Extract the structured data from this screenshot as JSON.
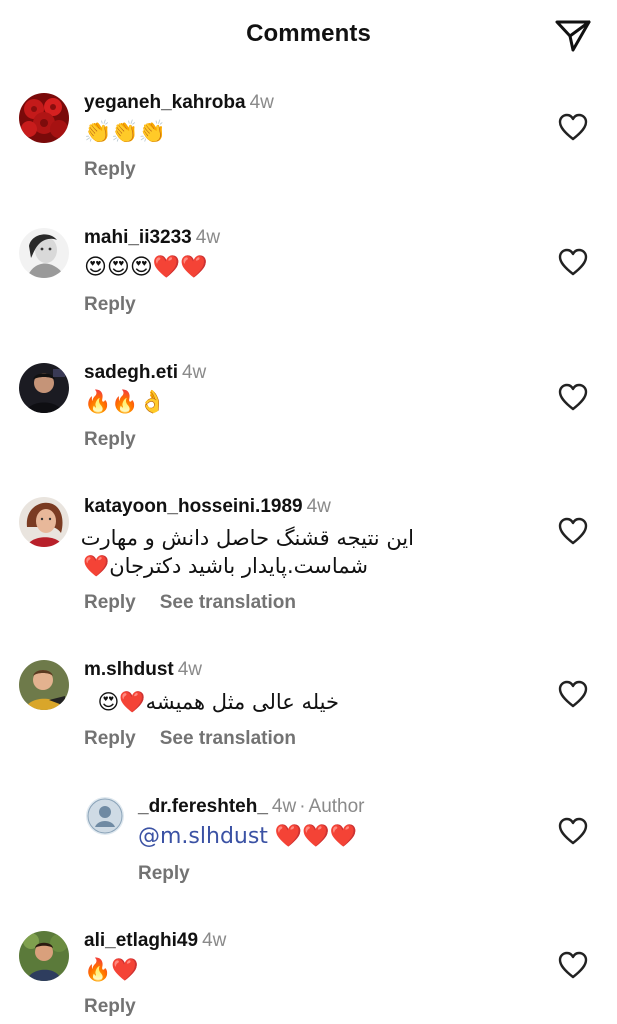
{
  "header": {
    "title": "Comments"
  },
  "comments": [
    {
      "username": "yeganeh_kahroba",
      "time": "4w",
      "text": "👏👏👏",
      "reply_label": "Reply"
    },
    {
      "username": "mahi_ii3233",
      "time": "4w",
      "text": "😍😍😍❤️❤️",
      "reply_label": "Reply"
    },
    {
      "username": "sadegh.eti",
      "time": "4w",
      "text": "🔥🔥👌",
      "reply_label": "Reply"
    },
    {
      "username": "katayoon_hosseini.1989",
      "time": "4w",
      "text_line1": "این نتیجه قشنگ حاصل دانش و مهارت",
      "text_line2": "شماست.پایدار باشید دکترجان❤️",
      "reply_label": "Reply",
      "translate_label": "See translation"
    },
    {
      "username": "m.slhdust",
      "time": "4w",
      "text": "خیله عالی مثل همیشه❤️😍",
      "reply_label": "Reply",
      "translate_label": "See translation"
    },
    {
      "username": "_dr.fereshteh_",
      "time": "4w",
      "author_label": "Author",
      "mention": "@m.slhdust",
      "text": " ❤️❤️❤️",
      "reply_label": "Reply"
    },
    {
      "username": "ali_etlaghi49",
      "time": "4w",
      "text": "🔥❤️",
      "reply_label": "Reply"
    }
  ],
  "icons": {
    "send": "paper-plane-icon",
    "like": "heart-outline-icon"
  },
  "colors": {
    "text": "#111111",
    "secondary": "#737373",
    "mention": "#3b52a4",
    "heart": "#e0262f"
  }
}
